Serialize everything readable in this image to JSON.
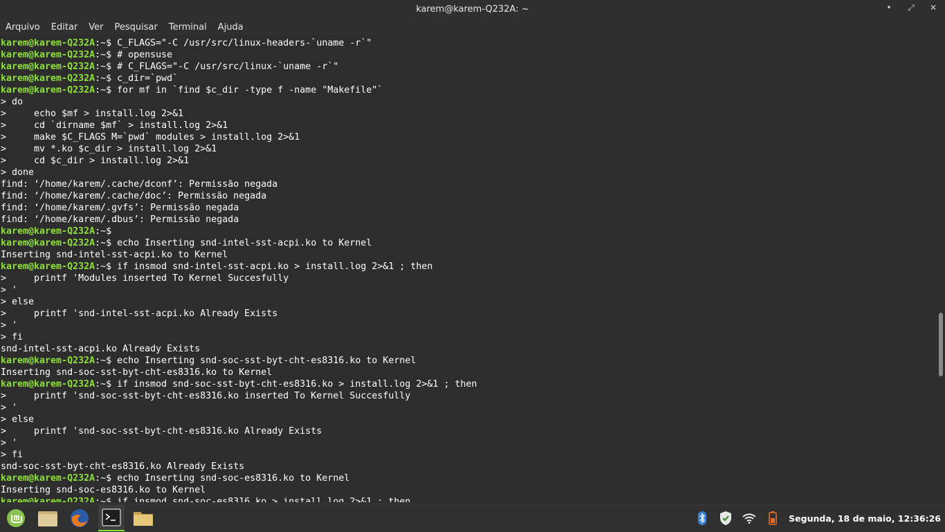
{
  "window": {
    "title": "karem@karem-Q232A: ~",
    "controls": {
      "minimize": "•",
      "restore": "⤢",
      "close": "✕"
    }
  },
  "menu": [
    "Arquivo",
    "Editar",
    "Ver",
    "Pesquisar",
    "Terminal",
    "Ajuda"
  ],
  "prompt": {
    "user": "karem@karem-Q232A",
    "path": ":~",
    "symbol": "$ "
  },
  "terminal_lines": [
    {
      "prompt": true,
      "text": "C_FLAGS=\"-C /usr/src/linux-headers-`uname -r`\""
    },
    {
      "prompt": true,
      "text": "# opensuse"
    },
    {
      "prompt": true,
      "text": "# C_FLAGS=\"-C /usr/src/linux-`uname -r`\""
    },
    {
      "prompt": true,
      "text": "c_dir=`pwd`"
    },
    {
      "prompt": true,
      "text": "for mf in `find $c_dir -type f -name \"Makefile\"`"
    },
    {
      "prompt": false,
      "text": "> do"
    },
    {
      "prompt": false,
      "text": ">     echo $mf > install.log 2>&1"
    },
    {
      "prompt": false,
      "text": ">     cd `dirname $mf` > install.log 2>&1"
    },
    {
      "prompt": false,
      "text": ">     make $C_FLAGS M=`pwd` modules > install.log 2>&1"
    },
    {
      "prompt": false,
      "text": ">     mv *.ko $c_dir > install.log 2>&1"
    },
    {
      "prompt": false,
      "text": ">     cd $c_dir > install.log 2>&1"
    },
    {
      "prompt": false,
      "text": "> done"
    },
    {
      "prompt": false,
      "text": "find: ‘/home/karem/.cache/dconf’: Permissão negada"
    },
    {
      "prompt": false,
      "text": "find: ‘/home/karem/.cache/doc’: Permissão negada"
    },
    {
      "prompt": false,
      "text": "find: ‘/home/karem/.gvfs’: Permissão negada"
    },
    {
      "prompt": false,
      "text": "find: ‘/home/karem/.dbus’: Permissão negada"
    },
    {
      "prompt": true,
      "text": ""
    },
    {
      "prompt": true,
      "text": "echo Inserting snd-intel-sst-acpi.ko to Kernel"
    },
    {
      "prompt": false,
      "text": "Inserting snd-intel-sst-acpi.ko to Kernel"
    },
    {
      "prompt": true,
      "text": "if insmod snd-intel-sst-acpi.ko > install.log 2>&1 ; then"
    },
    {
      "prompt": false,
      "text": ">     printf 'Modules inserted To Kernel Succesfully"
    },
    {
      "prompt": false,
      "text": "> '"
    },
    {
      "prompt": false,
      "text": "> else"
    },
    {
      "prompt": false,
      "text": ">     printf 'snd-intel-sst-acpi.ko Already Exists"
    },
    {
      "prompt": false,
      "text": "> '"
    },
    {
      "prompt": false,
      "text": "> fi"
    },
    {
      "prompt": false,
      "text": "snd-intel-sst-acpi.ko Already Exists"
    },
    {
      "prompt": true,
      "text": "echo Inserting snd-soc-sst-byt-cht-es8316.ko to Kernel"
    },
    {
      "prompt": false,
      "text": "Inserting snd-soc-sst-byt-cht-es8316.ko to Kernel"
    },
    {
      "prompt": true,
      "text": "if insmod snd-soc-sst-byt-cht-es8316.ko > install.log 2>&1 ; then"
    },
    {
      "prompt": false,
      "text": ">     printf 'snd-soc-sst-byt-cht-es8316.ko inserted To Kernel Succesfully"
    },
    {
      "prompt": false,
      "text": "> '"
    },
    {
      "prompt": false,
      "text": "> else"
    },
    {
      "prompt": false,
      "text": ">     printf 'snd-soc-sst-byt-cht-es8316.ko Already Exists"
    },
    {
      "prompt": false,
      "text": "> '"
    },
    {
      "prompt": false,
      "text": "> fi"
    },
    {
      "prompt": false,
      "text": "snd-soc-sst-byt-cht-es8316.ko Already Exists"
    },
    {
      "prompt": true,
      "text": "echo Inserting snd-soc-es8316.ko to Kernel"
    },
    {
      "prompt": false,
      "text": "Inserting snd-soc-es8316.ko to Kernel"
    },
    {
      "prompt": true,
      "text": "if insmod snd-soc-es8316.ko > install.log 2>&1 ; then"
    }
  ],
  "taskbar": {
    "apps": [
      {
        "name": "mint-menu-icon",
        "active": false
      },
      {
        "name": "files-icon",
        "active": false
      },
      {
        "name": "firefox-icon",
        "active": false
      },
      {
        "name": "terminal-icon",
        "active": true
      },
      {
        "name": "folder-icon",
        "active": false
      }
    ],
    "tray": [
      "bluetooth-icon",
      "update-shield-icon",
      "wifi-icon",
      "battery-icon"
    ],
    "clock": "Segunda, 18 de maio, 12:36:26"
  },
  "colors": {
    "prompt_user": "#8ae234",
    "background": "#2d2d2d",
    "text": "#ffffff"
  }
}
